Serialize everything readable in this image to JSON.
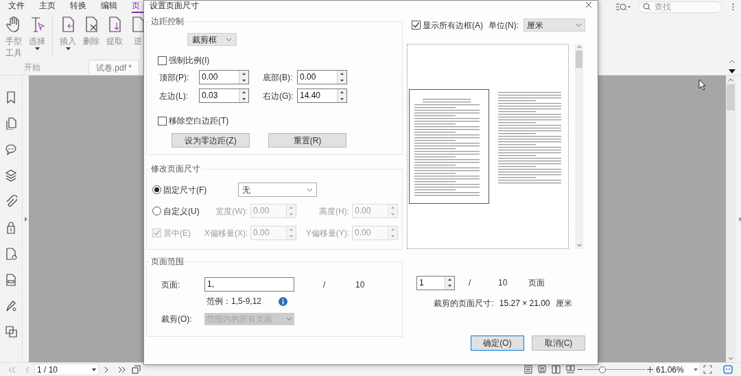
{
  "app": {
    "menu": [
      {
        "label": "文件",
        "selected": false
      },
      {
        "label": "主页",
        "selected": false
      },
      {
        "label": "转换",
        "selected": false
      },
      {
        "label": "编辑",
        "selected": false
      },
      {
        "label": "页",
        "selected": true
      }
    ],
    "search": {
      "placeholder": "查找"
    },
    "ribbon": [
      {
        "kind": "hand",
        "label": "手型工具",
        "dropdown": false
      },
      {
        "kind": "select",
        "label": "选择",
        "dropdown": true
      },
      {
        "kind": "insert",
        "label": "插入",
        "dropdown": true
      },
      {
        "kind": "delete",
        "label": "删除",
        "dropdown": false
      },
      {
        "kind": "extract",
        "label": "提取",
        "dropdown": false
      },
      {
        "kind": "reverse",
        "label": "逆",
        "dropdown": false
      }
    ],
    "tabs": [
      {
        "label": "开始",
        "selected": false
      },
      {
        "label": "试卷.pdf *",
        "selected": true
      }
    ],
    "status_bar": {
      "page": "1 / 10",
      "zoom_slider": {
        "level": 0.3
      },
      "zoom": "61.06%"
    }
  },
  "dialog": {
    "title": "设置页面尺寸",
    "margins": {
      "legend": "边距控制",
      "box": "裁剪框",
      "constrain": {
        "label": "强制比例(I)",
        "checked": false
      },
      "fields": [
        {
          "label": "顶部(P):",
          "value": "0.00"
        },
        {
          "label": "底部(B):",
          "value": "0.00"
        },
        {
          "label": "左边(L):",
          "value": "0.03"
        },
        {
          "label": "右边(G):",
          "value": "14.40"
        }
      ],
      "remove_white": {
        "label": "移除空白边距(T)",
        "checked": false
      },
      "buttons": [
        "设为零边距(Z)",
        "重置(R)"
      ]
    },
    "page_size": {
      "legend": "修改页面尺寸",
      "options": [
        {
          "label": "固定尺寸(F)",
          "selected": true
        },
        {
          "label": "自定义(U)",
          "selected": false
        }
      ],
      "fixed": "无",
      "fields": [
        {
          "label": "宽度(W):",
          "value": "0.00",
          "disabled": true
        },
        {
          "label": "高度(H):",
          "value": "0.00",
          "disabled": true
        },
        {
          "label": "X偏移量(X):",
          "value": "0.00",
          "disabled": true
        },
        {
          "label": "Y偏移量(Y):",
          "value": "0.00",
          "disabled": true
        }
      ],
      "center": {
        "label": "居中(E)",
        "checked": true,
        "disabled": true
      }
    },
    "range": {
      "legend": "页面范围",
      "pages_label": "页面:",
      "pages": "1,",
      "slash": "/",
      "total": "10",
      "example": "范例：1,5-9,12",
      "crop_label": "裁剪(O):",
      "crop": "范围内的所有页面",
      "crop_disabled": true
    },
    "show_all": {
      "label": "显示所有边框(A)",
      "checked": true
    },
    "unit_label": "单位(N):",
    "unit": "厘米",
    "preview_page": {
      "value": "1",
      "slash": "/",
      "total": "10",
      "unit": "页面"
    },
    "size": {
      "label": "裁剪的页面尺寸:",
      "value": "15.27 × 21.00",
      "unit": "厘米"
    },
    "ok": "确定(O)",
    "cancel": "取消(C)"
  }
}
